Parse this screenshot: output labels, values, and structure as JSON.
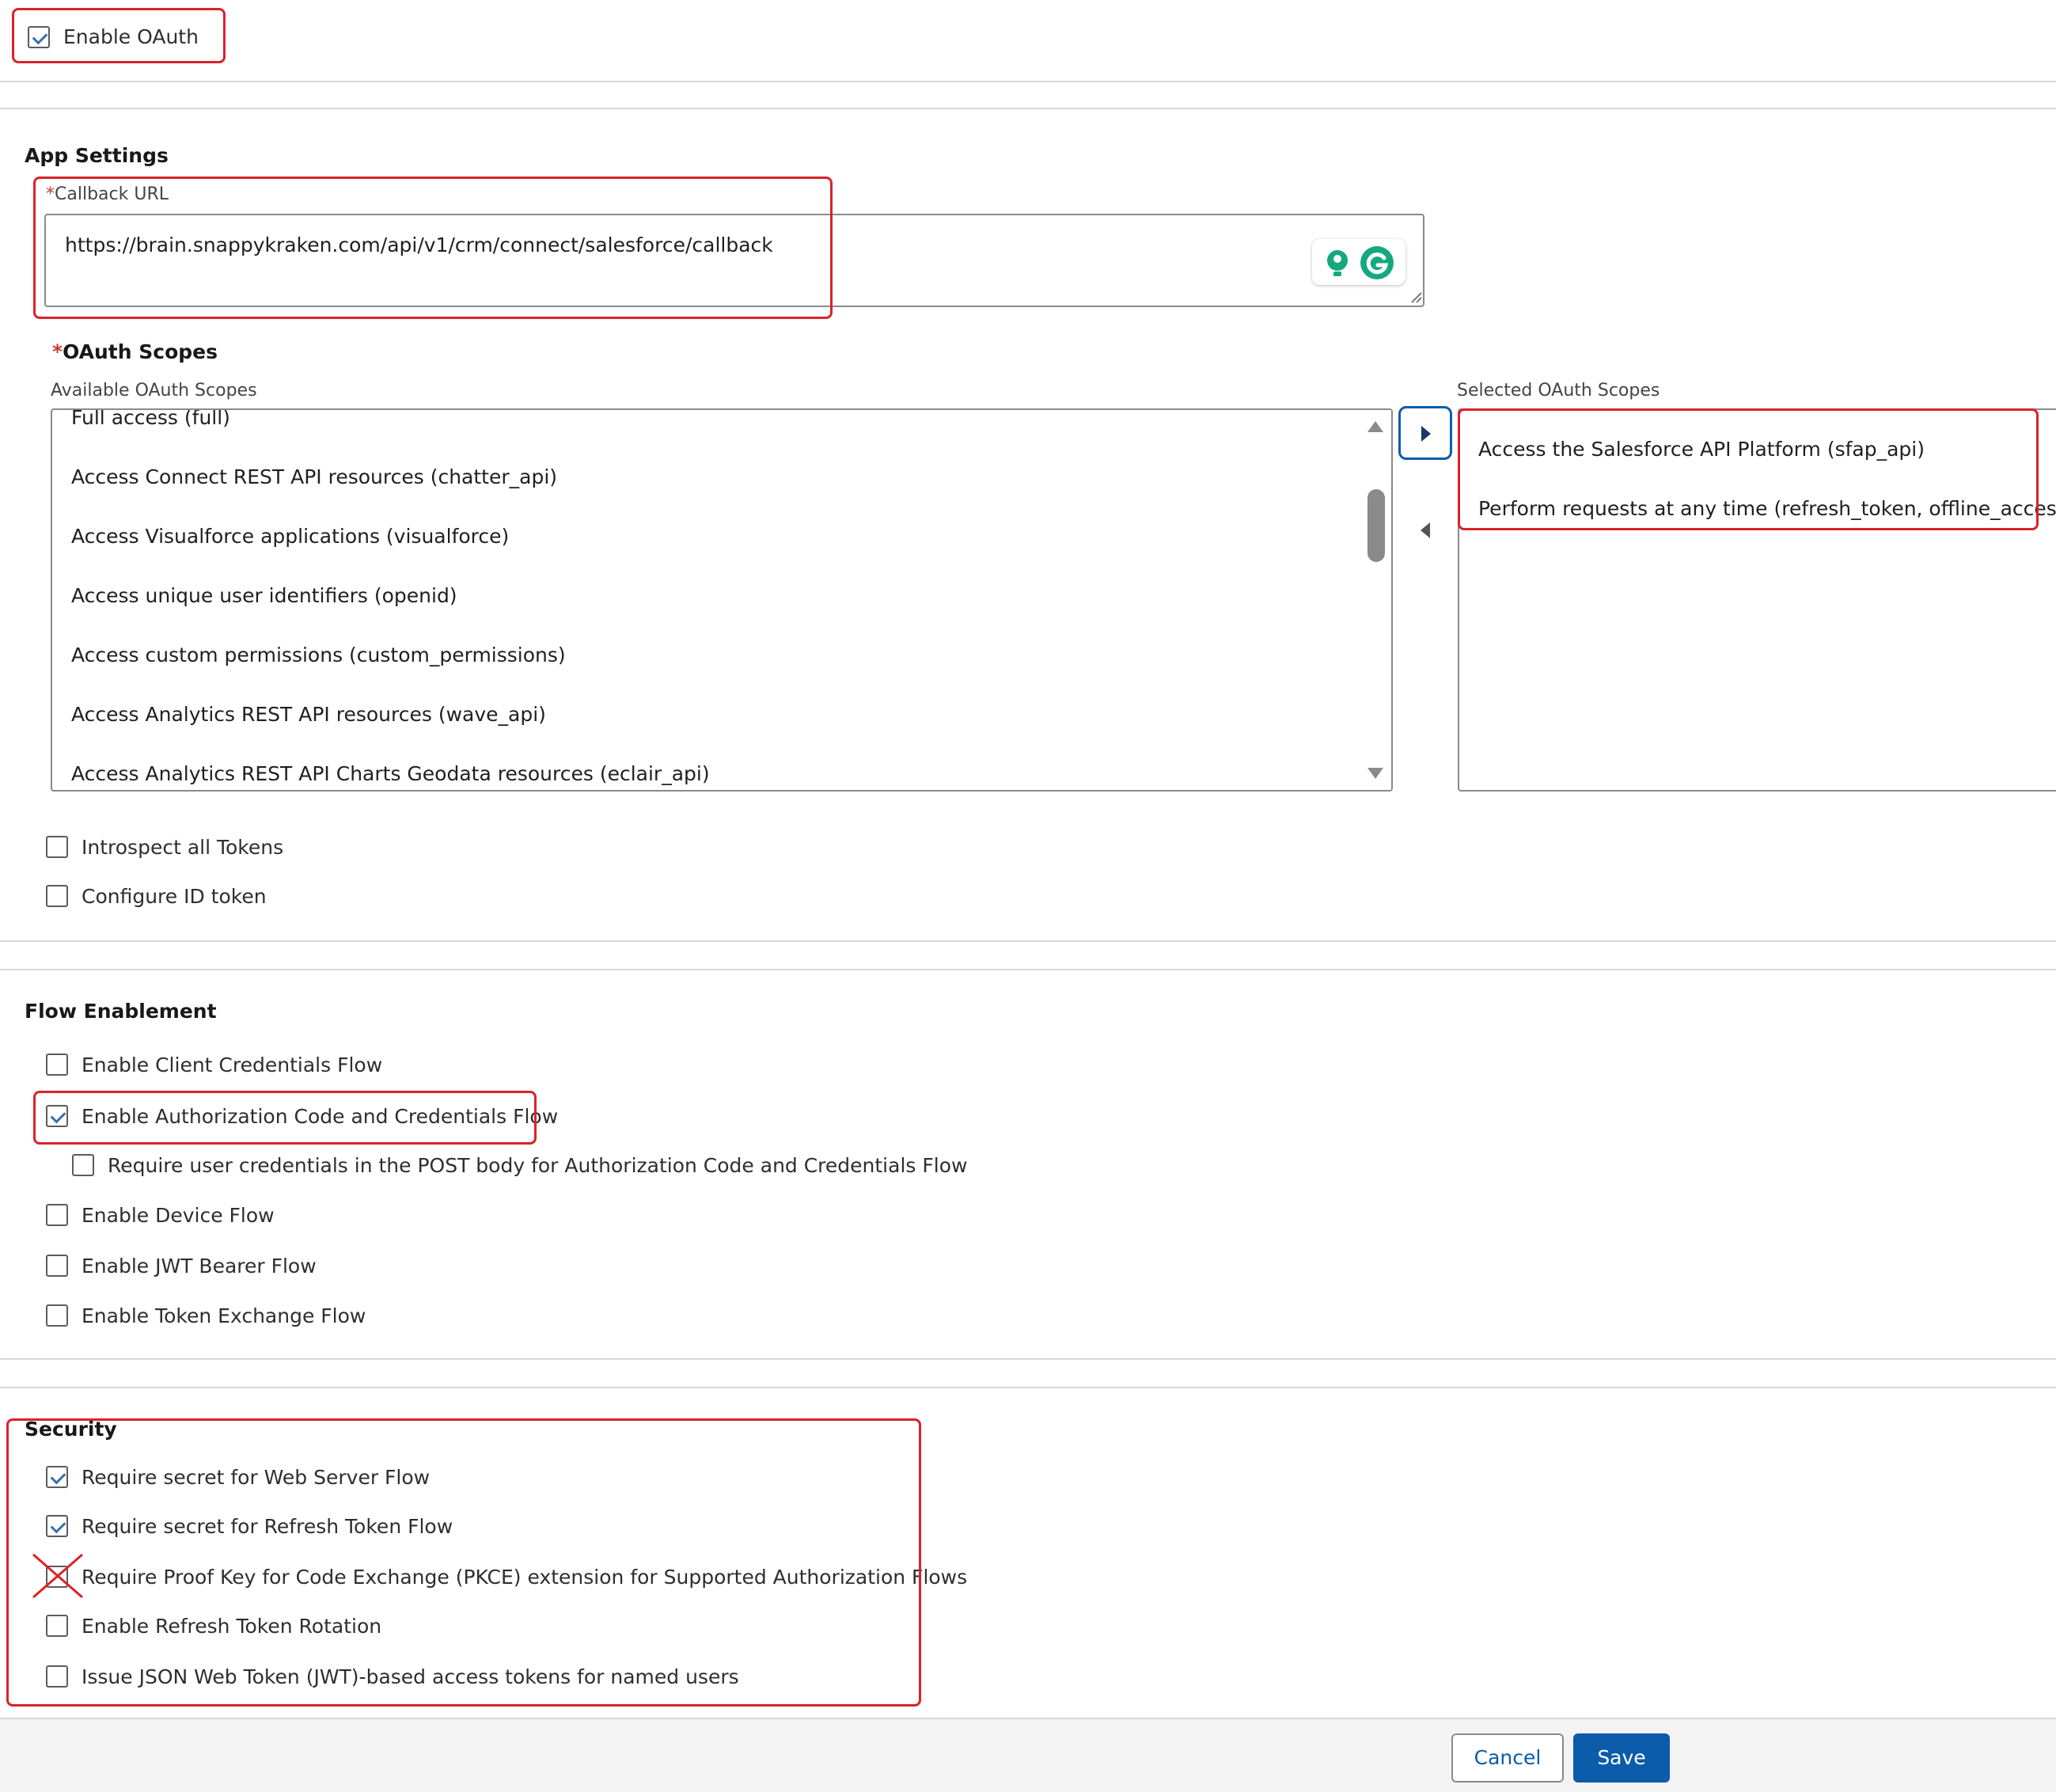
{
  "oauth": {
    "enable_label": "Enable OAuth",
    "enabled": true
  },
  "app_settings": {
    "heading": "App Settings",
    "required_mark": "*",
    "callback_label": "Callback URL",
    "callback_value": "https://brain.snappykraken.com/api/v1/crm/connect/salesforce/callback"
  },
  "scopes": {
    "heading": "OAuth Scopes",
    "available_label": "Available OAuth Scopes",
    "selected_label": "Selected OAuth Scopes",
    "available": [
      "Full access (full)",
      "Access Connect REST API resources (chatter_api)",
      "Access Visualforce applications (visualforce)",
      "Access unique user identifiers (openid)",
      "Access custom permissions (custom_permissions)",
      "Access Analytics REST API resources (wave_api)",
      "Access Analytics REST API Charts Geodata resources (eclair_api)"
    ],
    "selected": [
      "Access the Salesforce API Platform (sfap_api)",
      "Perform requests at any time (refresh_token, offline_access)"
    ]
  },
  "token_options": [
    {
      "label": "Introspect all Tokens",
      "checked": false
    },
    {
      "label": "Configure ID token",
      "checked": false
    }
  ],
  "flow": {
    "heading": "Flow Enablement",
    "items": [
      {
        "label": "Enable Client Credentials Flow",
        "checked": false
      },
      {
        "label": "Enable Authorization Code and Credentials Flow",
        "checked": true
      },
      {
        "label": "Require user credentials in the POST body for Authorization Code and Credentials Flow",
        "checked": false
      },
      {
        "label": "Enable Device Flow",
        "checked": false
      },
      {
        "label": "Enable JWT Bearer Flow",
        "checked": false
      },
      {
        "label": "Enable Token Exchange Flow",
        "checked": false
      }
    ]
  },
  "security": {
    "heading": "Security",
    "items": [
      {
        "label": "Require secret for Web Server Flow",
        "checked": true
      },
      {
        "label": "Require secret for Refresh Token Flow",
        "checked": true
      },
      {
        "label": "Require Proof Key for Code Exchange (PKCE) extension for Supported Authorization Flows",
        "checked": false,
        "crossed_out": true
      },
      {
        "label": "Enable Refresh Token Rotation",
        "checked": false
      },
      {
        "label": "Issue JSON Web Token (JWT)-based access tokens for named users",
        "checked": false
      }
    ]
  },
  "footer": {
    "cancel_label": "Cancel",
    "save_label": "Save"
  },
  "colors": {
    "highlight": "#d9232a",
    "brand_blue": "#0b5cab",
    "check_blue": "#3a6fb0",
    "footer_bg": "#f3f3f3"
  },
  "icons": [
    "check-icon",
    "lightbulb-icon",
    "grammarly-icon",
    "resize-handle-icon",
    "arrow-right-icon",
    "arrow-left-icon",
    "scroll-up-icon",
    "scroll-down-icon",
    "red-x-icon"
  ]
}
